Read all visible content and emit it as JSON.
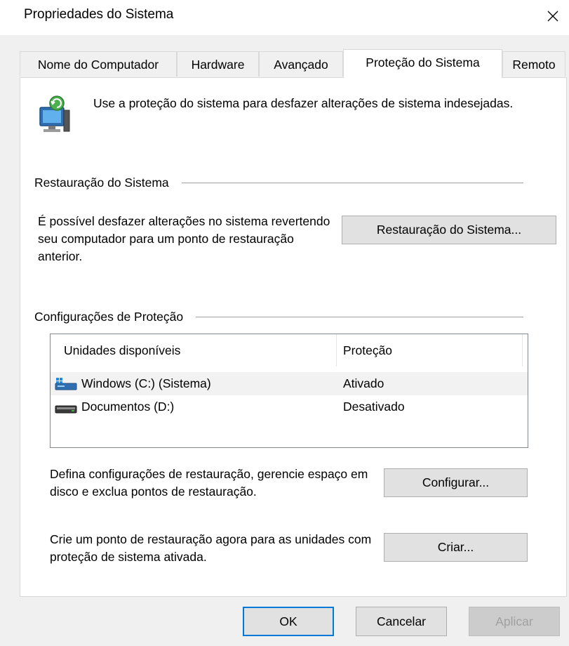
{
  "window": {
    "title": "Propriedades do Sistema",
    "close_label": "×"
  },
  "tabs": [
    {
      "label": "Nome do Computador",
      "active": false
    },
    {
      "label": "Hardware",
      "active": false
    },
    {
      "label": "Avançado",
      "active": false
    },
    {
      "label": "Proteção do Sistema",
      "active": true
    },
    {
      "label": "Remoto",
      "active": false
    }
  ],
  "intro": {
    "text": "Use a proteção do sistema para desfazer alterações de sistema indesejadas."
  },
  "restore": {
    "group_title": "Restauração do Sistema",
    "description": "É possível desfazer alterações no sistema revertendo seu computador para um ponto de restauração anterior.",
    "button_label": "Restauração do Sistema..."
  },
  "protection": {
    "group_title": "Configurações de Proteção",
    "columns": [
      "Unidades disponíveis",
      "Proteção"
    ],
    "drives": [
      {
        "name": "Windows (C:) (Sistema)",
        "status": "Ativado",
        "icon": "system-drive-icon",
        "selected": true
      },
      {
        "name": "Documentos (D:)",
        "status": "Desativado",
        "icon": "drive-icon",
        "selected": false
      }
    ],
    "configure_text": "Defina configurações de restauração, gerencie espaço em disco e exclua pontos de restauração.",
    "configure_button": "Configurar...",
    "create_text": "Crie um ponto de restauração agora para as unidades com proteção de sistema ativada.",
    "create_button": "Criar..."
  },
  "footer": {
    "ok": "OK",
    "cancel": "Cancelar",
    "apply": "Aplicar"
  }
}
